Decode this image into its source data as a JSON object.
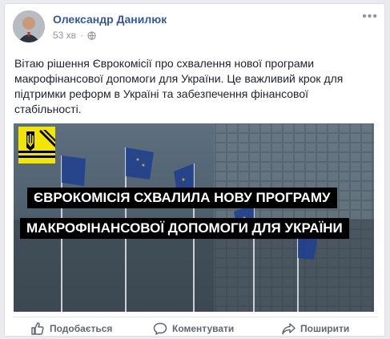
{
  "post": {
    "author": "Олександр Данилюк",
    "time": "53 хв",
    "text_lines": [
      "Вітаю рішення Єврокомісії про схвалення нової програми",
      "макрофінансової допомоги для України. Це важливий крок для",
      "підтримки реформ в Україні та забезпечення фінансової",
      "стабільності."
    ],
    "image": {
      "line1": "Єврокомісія схвалила нову програму",
      "line2": "макрофінансової допомоги для України"
    }
  },
  "actions": {
    "like": "Подобається",
    "comment": "Коментувати",
    "share": "Поширити"
  },
  "colors": {
    "author": "#365899",
    "meta": "#90949c",
    "emblem": "#f2e600",
    "banner_bg": "#000000"
  }
}
